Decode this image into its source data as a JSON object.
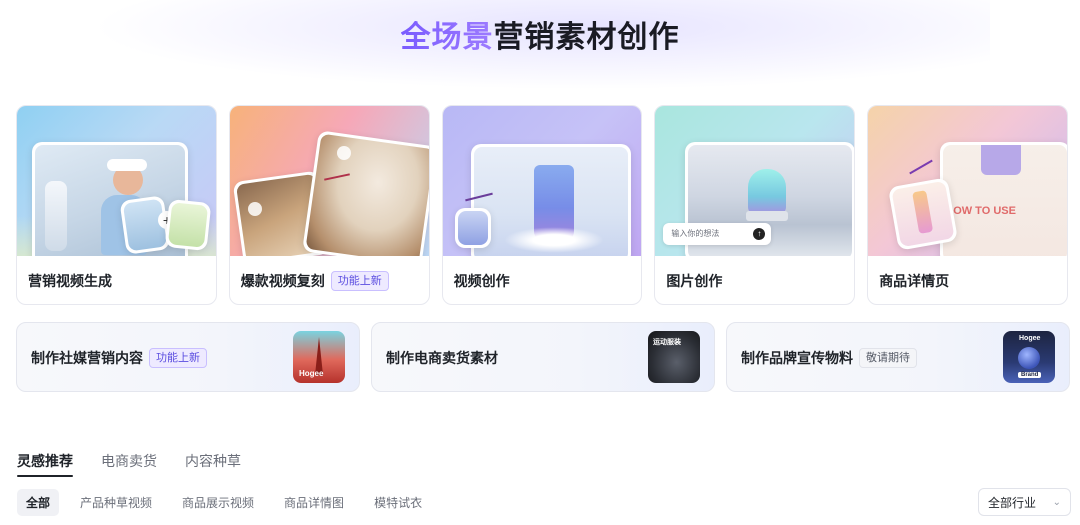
{
  "hero": {
    "title_accent": "全场景",
    "title_rest": "营销素材创作"
  },
  "feature_cards": [
    {
      "label": "营销视频生成",
      "badge": ""
    },
    {
      "label": "爆款视频复刻",
      "badge": "功能上新"
    },
    {
      "label": "视频创作",
      "badge": ""
    },
    {
      "label": "图片创作",
      "badge": "",
      "input_placeholder": "输入你的想法"
    },
    {
      "label": "商品详情页",
      "badge": "",
      "poster_text": "OW TO USE"
    }
  ],
  "actions": [
    {
      "label": "制作社媒营销内容",
      "badge": "功能上新",
      "thumb_text": "Hogee"
    },
    {
      "label": "制作电商卖货素材",
      "badge": "",
      "thumb_text": "运动服装"
    },
    {
      "label": "制作品牌宣传物料",
      "badge": "敬请期待",
      "thumb_text": "Hogee",
      "thumb_sub": "Brand"
    }
  ],
  "tabs": [
    {
      "label": "灵感推荐",
      "active": true
    },
    {
      "label": "电商卖货",
      "active": false
    },
    {
      "label": "内容种草",
      "active": false
    }
  ],
  "filters": [
    {
      "label": "全部",
      "active": true
    },
    {
      "label": "产品种草视频",
      "active": false
    },
    {
      "label": "商品展示视频",
      "active": false
    },
    {
      "label": "商品详情图",
      "active": false
    },
    {
      "label": "模特试衣",
      "active": false
    }
  ],
  "industry_select": {
    "label": "全部行业",
    "icon": "chevron-down-icon"
  },
  "colors": {
    "accent": "#7a5cff",
    "badge_bg": "#eeeaff"
  }
}
